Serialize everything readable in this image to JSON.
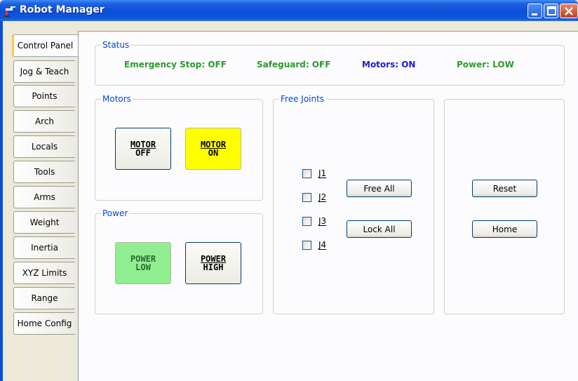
{
  "window": {
    "title": "Robot Manager"
  },
  "tabs": [
    {
      "label": "Control Panel",
      "active": true
    },
    {
      "label": "Jog & Teach"
    },
    {
      "label": "Points"
    },
    {
      "label": "Arch"
    },
    {
      "label": "Locals"
    },
    {
      "label": "Tools"
    },
    {
      "label": "Arms"
    },
    {
      "label": "Weight"
    },
    {
      "label": "Inertia"
    },
    {
      "label": "XYZ Limits"
    },
    {
      "label": "Range"
    },
    {
      "label": "Home Config"
    }
  ],
  "status": {
    "title": "Status",
    "emergency_stop": "Emergency Stop: OFF",
    "safeguard": "Safeguard: OFF",
    "motors": "Motors: ON",
    "power": "Power: LOW",
    "colors": {
      "ok": "#2b9a2b",
      "motors": "#1a1ad6"
    }
  },
  "motors": {
    "title": "Motors",
    "off_line1": "MOTOR",
    "off_line2": "OFF",
    "on_line1": "MOTOR",
    "on_line2": "ON",
    "on_color": "#ffff00"
  },
  "power": {
    "title": "Power",
    "low_line1": "POWER",
    "low_line2": "LOW",
    "high_line1": "POWER",
    "high_line2": "HIGH",
    "low_color": "#90ee90"
  },
  "free_joints": {
    "title": "Free Joints",
    "joints": [
      "J1",
      "J2",
      "J3",
      "J4"
    ],
    "free_all": "Free All",
    "lock_all": "Lock All"
  },
  "actions": {
    "reset": "Reset",
    "home": "Home"
  }
}
